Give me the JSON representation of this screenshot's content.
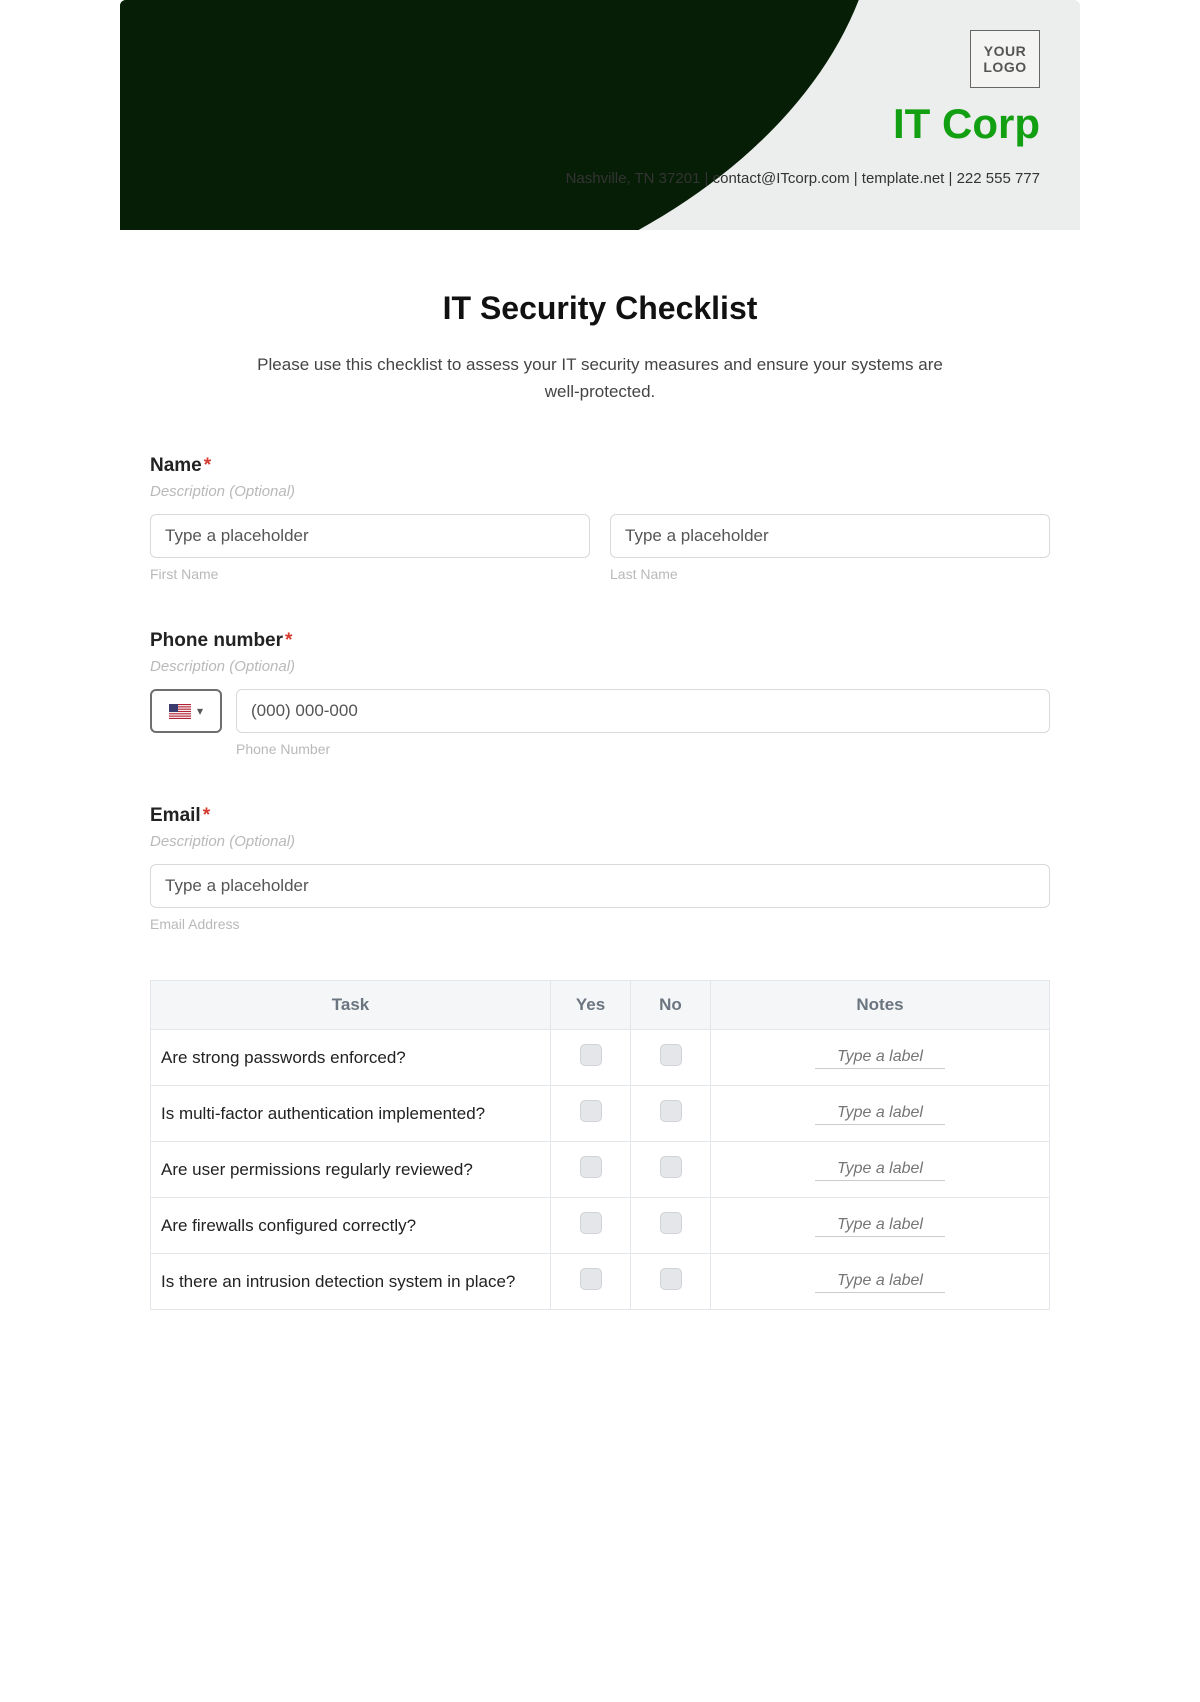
{
  "header": {
    "logo_placeholder_line1": "YOUR",
    "logo_placeholder_line2": "LOGO",
    "brand": "IT Corp",
    "contact_line": "Nashville, TN 37201 | contact@ITcorp.com | template.net | 222 555 777"
  },
  "title": "IT Security Checklist",
  "intro": "Please use this checklist to assess your IT security measures and ensure your systems are well-protected.",
  "fields": {
    "name": {
      "label": "Name",
      "description": "Description (Optional)",
      "first_placeholder": "Type a placeholder",
      "first_sublabel": "First Name",
      "last_placeholder": "Type a placeholder",
      "last_sublabel": "Last Name"
    },
    "phone": {
      "label": "Phone number",
      "description": "Description (Optional)",
      "placeholder": "(000) 000-000",
      "sublabel": "Phone Number"
    },
    "email": {
      "label": "Email",
      "description": "Description (Optional)",
      "placeholder": "Type a placeholder",
      "sublabel": "Email Address"
    }
  },
  "table": {
    "headers": {
      "task": "Task",
      "yes": "Yes",
      "no": "No",
      "notes": "Notes"
    },
    "note_placeholder": "Type a label",
    "rows": [
      {
        "task": "Are strong passwords enforced?"
      },
      {
        "task": "Is multi-factor authentication implemented?"
      },
      {
        "task": "Are user permissions regularly reviewed?"
      },
      {
        "task": "Are firewalls configured correctly?"
      },
      {
        "task": "Is there an intrusion detection system in place?"
      }
    ]
  }
}
